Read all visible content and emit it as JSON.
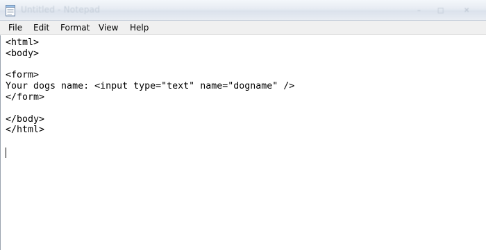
{
  "window": {
    "title": "Untitled - Notepad",
    "controls": {
      "minimize": "–",
      "maximize": "□",
      "close": "✕"
    }
  },
  "menubar": {
    "items": [
      "File",
      "Edit",
      "Format",
      "View",
      "Help"
    ]
  },
  "editor": {
    "content": "<html>\n<body>\n\n<form>\nYour dogs name: <input type=\"text\" name=\"dogname\" />\n</form>\n\n</body>\n</html>"
  },
  "icons": {
    "app": "notepad-icon"
  }
}
